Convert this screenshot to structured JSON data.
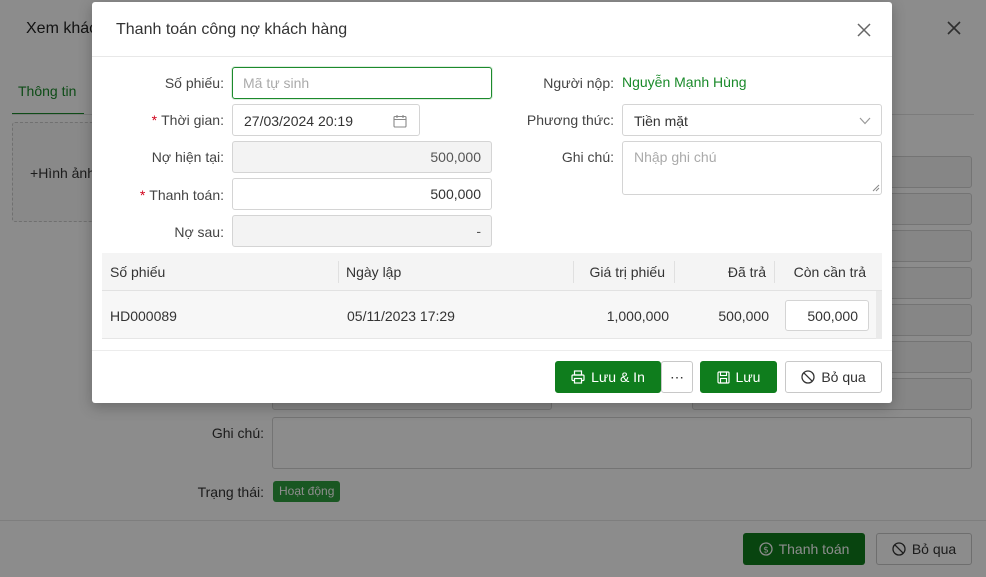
{
  "background": {
    "title": "Xem khác",
    "tab_info": "Thông tin",
    "image_button": "Hình ảnh",
    "note_label": "Ghi chú:",
    "status_label": "Trạng thái:",
    "status_badge": "Hoạt động",
    "pay_button": "Thanh toán",
    "cancel_button": "Bỏ qua"
  },
  "modal": {
    "title": "Thanh toán công nợ khách hàng",
    "form": {
      "receipt_no_label": "Số phiếu",
      "receipt_no_placeholder": "Mã tự sinh",
      "time_label": "Thời gian",
      "time_value": "27/03/2024 20:19",
      "current_debt_label": "Nợ hiện tại",
      "current_debt_value": "500,000",
      "payment_label": "Thanh toán",
      "payment_value": "500,000",
      "debt_after_label": "Nợ sau",
      "debt_after_value": "-",
      "payer_label": "Người nộp",
      "payer_value": "Nguyễn Mạnh Hùng",
      "method_label": "Phương thức",
      "method_value": "Tiền mặt",
      "note_label": "Ghi chú",
      "note_placeholder": "Nhập ghi chú",
      "colon": ":"
    },
    "table": {
      "headers": [
        "Số phiếu",
        "Ngày lập",
        "Giá trị phiếu",
        "Đã trả",
        "Còn cần trả"
      ],
      "rows": [
        {
          "receipt": "HD000089",
          "date": "05/11/2023 17:29",
          "value": "1,000,000",
          "paid": "500,000",
          "remaining": "500,000"
        }
      ]
    },
    "buttons": {
      "save_print": "Lưu & In",
      "more": "⋯",
      "save": "Lưu",
      "skip": "Bỏ qua"
    }
  },
  "colors": {
    "primary": "#0f7d1d",
    "link_green": "#1a8a2a",
    "required": "#d0021b"
  }
}
